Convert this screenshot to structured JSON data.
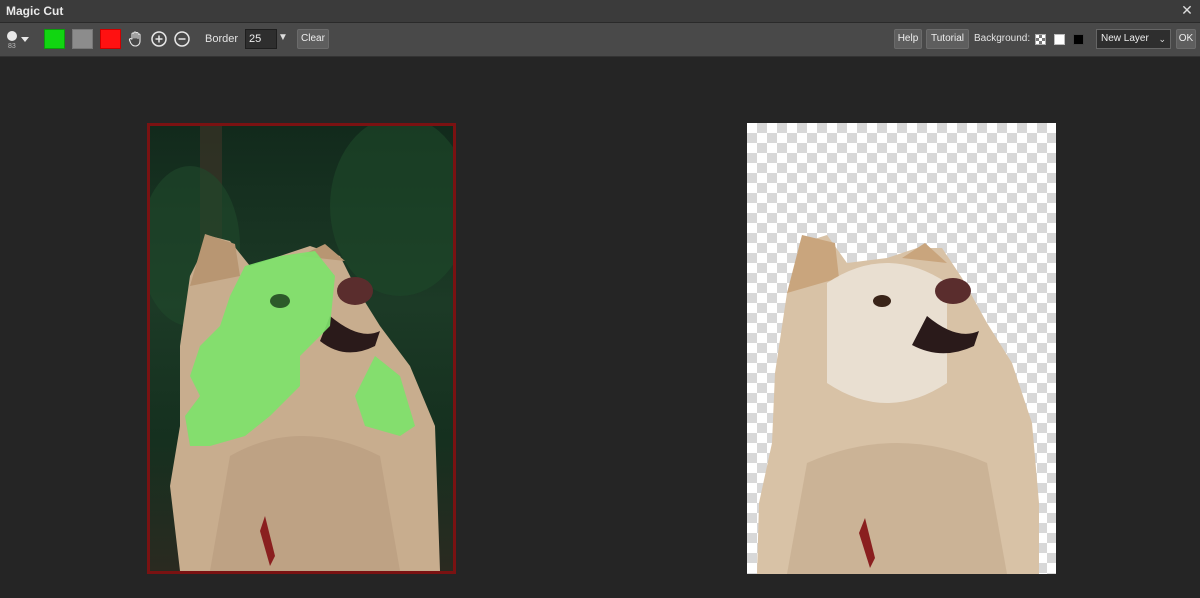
{
  "window": {
    "title": "Magic Cut",
    "close_glyph": "✕"
  },
  "toolbar": {
    "brush_size": "83",
    "border_label": "Border",
    "border_value": "25",
    "clear_label": "Clear",
    "help_label": "Help",
    "tutorial_label": "Tutorial",
    "background_label": "Background:",
    "layer_selected": "New Layer",
    "ok_label": "OK"
  },
  "colors": {
    "keep": "#11d611",
    "unknown": "#8c8c8c",
    "remove": "#ff1111",
    "mask_overlay": "#7ee26b",
    "frame": "#7a1212"
  },
  "icons": {
    "brush": "brush-icon",
    "hand": "hand-icon",
    "zoom_in": "zoom-in-icon",
    "zoom_out": "zoom-out-icon"
  }
}
